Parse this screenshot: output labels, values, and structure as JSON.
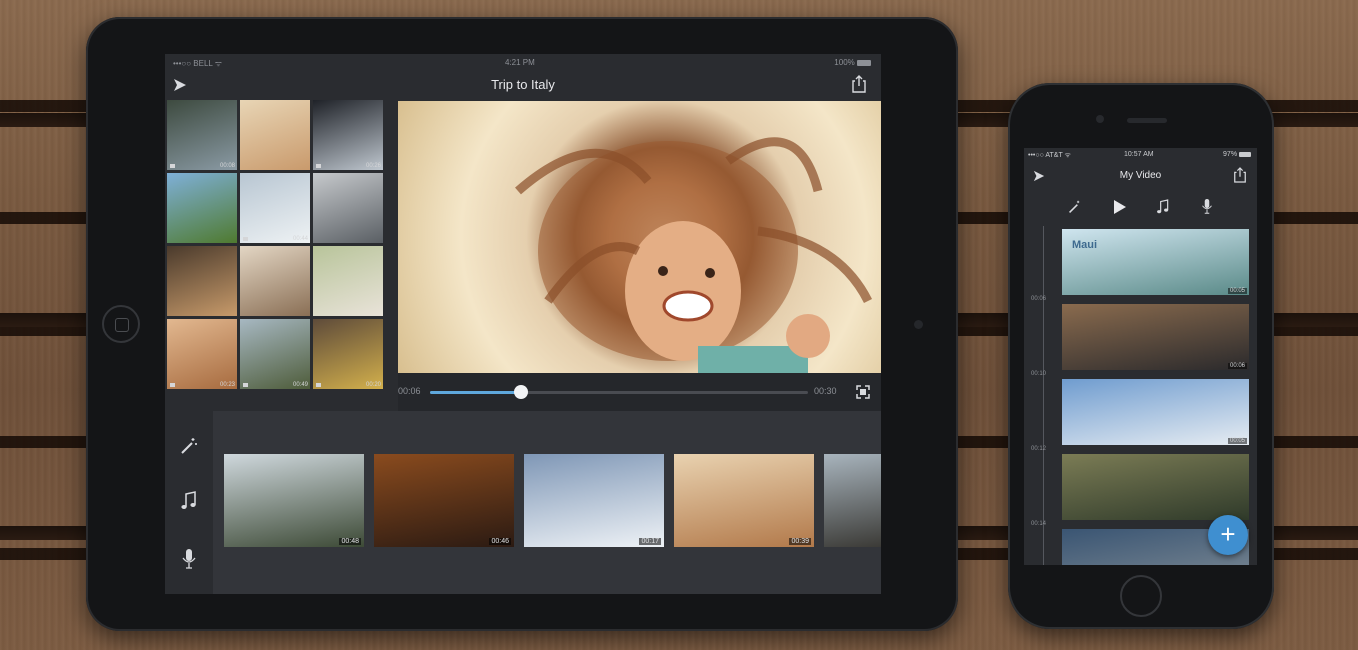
{
  "ipad": {
    "status": {
      "carrier": "•••○○ BELL ᯤ",
      "time": "4:21 PM",
      "battery": "100%"
    },
    "title": "Trip to Italy",
    "icons": {
      "logo": "play-logo-icon",
      "share": "share-icon",
      "magic": "magic-wand-icon",
      "music": "music-note-icon",
      "mic": "microphone-icon",
      "fullscreen": "fullscreen-icon"
    },
    "library": [
      {
        "duration": "00:08",
        "colors": [
          "#3d4a3f",
          "#8a9aa4"
        ]
      },
      {
        "duration": "",
        "colors": [
          "#e8d5b5",
          "#c99a6c"
        ]
      },
      {
        "duration": "00:26",
        "colors": [
          "#1f2228",
          "#bfc7cf"
        ]
      },
      {
        "duration": "",
        "colors": [
          "#7fb0d8",
          "#4f7a2f"
        ]
      },
      {
        "duration": "00:44",
        "colors": [
          "#b8c6d2",
          "#eef2f4"
        ]
      },
      {
        "duration": "",
        "colors": [
          "#c6c9cc",
          "#5a5f64"
        ]
      },
      {
        "duration": "",
        "colors": [
          "#4a3a2c",
          "#c79a6a"
        ]
      },
      {
        "duration": "",
        "colors": [
          "#e3d6c4",
          "#8a6f55"
        ]
      },
      {
        "duration": "",
        "colors": [
          "#b8c49a",
          "#e9e3d9"
        ]
      },
      {
        "duration": "00:23",
        "colors": [
          "#e2b890",
          "#a76b3f"
        ]
      },
      {
        "duration": "00:49",
        "colors": [
          "#a7b8c2",
          "#4e5c3a"
        ]
      },
      {
        "duration": "00:20",
        "colors": [
          "#5e4b3a",
          "#d3b04c"
        ]
      }
    ],
    "player": {
      "current": "00:06",
      "total": "00:30",
      "progress": 0.24
    },
    "timeline": [
      {
        "duration": "00:48",
        "colors": [
          "#cfd8dd",
          "#3d4a36"
        ]
      },
      {
        "duration": "00:46",
        "colors": [
          "#8a4b1e",
          "#2b1a12"
        ]
      },
      {
        "duration": "00:17",
        "colors": [
          "#7f97b6",
          "#eef2f6"
        ]
      },
      {
        "duration": "00:39",
        "colors": [
          "#e9d2b0",
          "#b2794a"
        ]
      },
      {
        "duration": "",
        "colors": [
          "#a8b4bd",
          "#3b3a36"
        ]
      }
    ]
  },
  "iphone": {
    "status": {
      "carrier": "•••○○ AT&T ᯤ",
      "time": "10:57 AM",
      "battery": "97%"
    },
    "title": "My Video",
    "icons": {
      "magic": "magic-wand-icon",
      "play": "play-icon",
      "music": "music-note-icon",
      "mic": "microphone-icon",
      "add": "plus-icon"
    },
    "add_label": "+",
    "timestamps": [
      "00:06",
      "00:10",
      "00:12",
      "00:14"
    ],
    "clips": [
      {
        "title": "Maui",
        "duration": "00:05",
        "colors": [
          "#cfe5ef",
          "#5a8a88"
        ]
      },
      {
        "title": "",
        "duration": "00:06",
        "colors": [
          "#8a6b4e",
          "#2b2a2c"
        ]
      },
      {
        "title": "",
        "duration": "00:05",
        "colors": [
          "#6f9ccf",
          "#e6ecf2"
        ]
      },
      {
        "title": "",
        "duration": "",
        "colors": [
          "#7b7c55",
          "#2f3a2a"
        ]
      },
      {
        "title": "",
        "duration": "",
        "colors": [
          "#3a5573",
          "#6d7d8c"
        ]
      }
    ]
  }
}
